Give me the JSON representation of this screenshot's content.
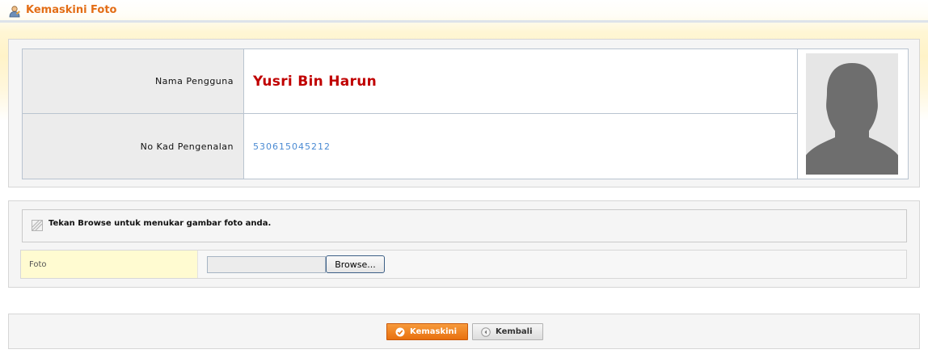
{
  "header": {
    "title": "Kemaskini Foto",
    "icon": "user-edit-icon"
  },
  "profile": {
    "name_label": "Nama Pengguna",
    "name_value": "Yusri Bin Harun",
    "ic_label": "No Kad Pengenalan",
    "ic_value": "530615045212",
    "photo": "silhouette-photo"
  },
  "upload": {
    "notice_icon": "info-stripe-icon",
    "notice_text": "Tekan Browse untuk menukar gambar foto anda.",
    "field_label": "Foto",
    "file_value": "",
    "browse_label": "Browse..."
  },
  "actions": {
    "submit_label": "Kemaskini",
    "submit_icon": "check-circle-icon",
    "back_label": "Kembali",
    "back_icon": "back-arrow-icon"
  },
  "colors": {
    "title": "#e36d16",
    "name": "#c00000",
    "ic": "#4a8ad3",
    "primary_button": "#f0821f"
  }
}
